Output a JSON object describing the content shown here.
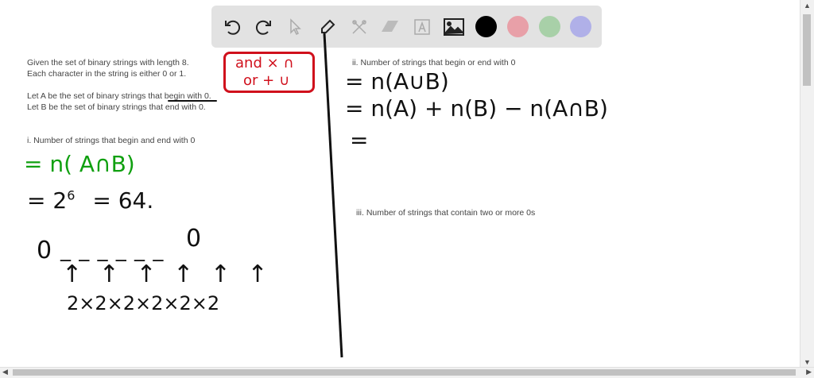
{
  "toolbar": {
    "tools": [
      "undo-icon",
      "redo-icon",
      "select-icon",
      "pen-icon",
      "tools-icon",
      "eraser-icon",
      "text-icon",
      "image-icon"
    ],
    "colors": [
      "#000000",
      "#e8a0a8",
      "#a8d0a8",
      "#b0b0e8"
    ]
  },
  "problem": {
    "line1": "Given the set of binary strings with length 8.",
    "line2": "Each character in the string is either 0 or 1.",
    "line3": "Let A be the set of binary strings that begin with 0.",
    "line4": "Let B be the set of binary strings that end with 0.",
    "q1": "i. Number of strings that begin and end with 0",
    "q2": "ii. Number of strings that begin or end with 0",
    "q3": "iii. Number of strings that contain two or more 0s"
  },
  "notes": {
    "box_line1": "and × ∩",
    "box_line2": "or + ∪",
    "q1_line1": "= n( A∩B)",
    "q1_line2a": "= 2",
    "q1_exp": "6",
    "q1_line2b": "= 64.",
    "zero_left": "0",
    "dashes": "_ _ _ _ _ _",
    "zero_right": "0",
    "arrows": "↑ ↑ ↑ ↑ ↑ ↑",
    "product": "2×2×2×2×2×2",
    "q2_line1": "= n(A∪B)",
    "q2_line2": "= n(A) + n(B) − n(A∩B)",
    "q2_line3": "="
  },
  "colors": {
    "red": "#d0101c",
    "green": "#10a010",
    "ink": "#111111"
  }
}
